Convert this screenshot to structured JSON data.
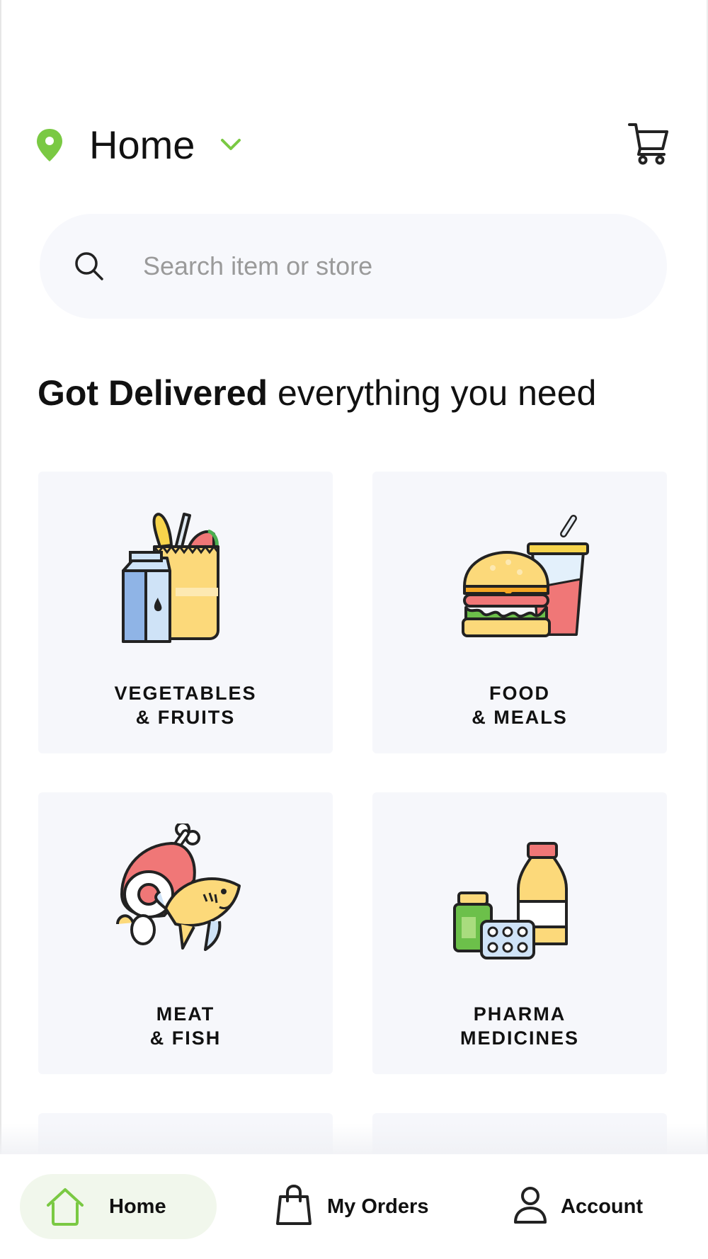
{
  "header": {
    "location_label": "Home",
    "location_icon": "map-pin-icon",
    "dropdown_icon": "chevron-down-icon",
    "cart_icon": "cart-icon"
  },
  "search": {
    "placeholder": "Search item or store",
    "icon": "search-icon"
  },
  "headline": {
    "bold": "Got Delivered",
    "rest": " everything you need"
  },
  "categories": [
    {
      "line1": "VEGETABLES",
      "line2": "& FRUITS",
      "icon": "grocery-bag-icon"
    },
    {
      "line1": "FOOD",
      "line2": "& MEALS",
      "icon": "burger-drink-icon"
    },
    {
      "line1": "MEAT",
      "line2": "& FISH",
      "icon": "meat-fish-icon"
    },
    {
      "line1": "PHARMA",
      "line2": "MEDICINES",
      "icon": "medicine-bottles-icon"
    }
  ],
  "nav": {
    "home": {
      "label": "Home",
      "icon": "home-icon",
      "active": true
    },
    "orders": {
      "label": "My Orders",
      "icon": "shopping-bag-icon"
    },
    "account": {
      "label": "Account",
      "icon": "user-icon"
    }
  },
  "colors": {
    "accent": "#7ac943",
    "tile_bg": "#f6f7fb",
    "search_bg": "#f7f8fc",
    "nav_active_bg": "#f1f7ec"
  }
}
